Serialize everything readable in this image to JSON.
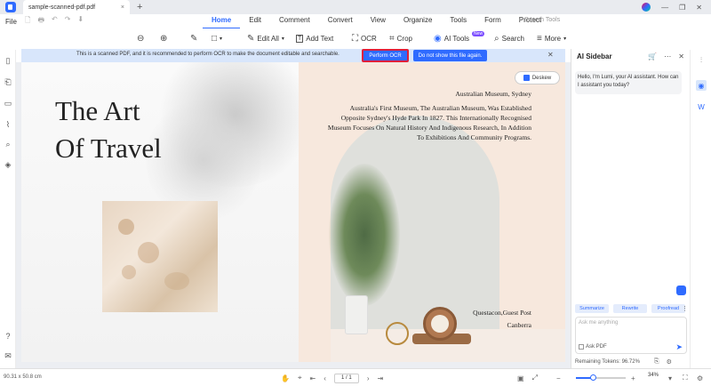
{
  "titlebar": {
    "tab_title": "sample-scanned-pdf.pdf",
    "close": "×",
    "new_tab": "+",
    "controls": [
      "—",
      "❐",
      "✕"
    ]
  },
  "menubar": {
    "file": "File",
    "quick_access": [
      "🗋",
      "🖶",
      "↶",
      "↷",
      "⬇"
    ],
    "menus": [
      {
        "label": "Home",
        "active": true
      },
      {
        "label": "Edit"
      },
      {
        "label": "Comment"
      },
      {
        "label": "Convert"
      },
      {
        "label": "View"
      },
      {
        "label": "Organize"
      },
      {
        "label": "Tools"
      },
      {
        "label": "Form"
      },
      {
        "label": "Protect"
      }
    ],
    "search_placeholder": "Search Tools"
  },
  "toolbar": {
    "zoom_out": "⊖",
    "zoom_in": "⊕",
    "highlight": "✎",
    "shape": "□",
    "edit_all": "Edit All",
    "add_text": "Add Text",
    "ocr": "OCR",
    "crop": "Crop",
    "ai_tools": "AI Tools",
    "ai_badge": "New",
    "search": "Search",
    "more": "More"
  },
  "infobar": {
    "message": "This is a scanned PDF, and it is recommended to perform OCR to make the document editable and searchable.",
    "perform_ocr": "Perform OCR",
    "dont_show": "Do not show this file again."
  },
  "page": {
    "title_line1": "The Art",
    "title_line2": "Of Travel",
    "deskew": "Deskew",
    "museum_heading": "Australian Museum, Sydney",
    "museum_text": "Australia's First Museum, The Australian Museum, Was Established Opposite Sydney's Hyde Park In 1827. This Internationally Recognised Museum Focuses On Natural History And Indigenous Research, In Addition To Exhibitions And Community Programs.",
    "quest_line1": "Questacon,Guest Post",
    "quest_line2": "Canberra"
  },
  "sidebar": {
    "title": "AI Sidebar",
    "greeting": "Hello, I'm Lumi, your AI assistant. How can I assistant you today?",
    "chips": [
      "Summarize",
      "Rewrite",
      "Proofread"
    ],
    "ask_placeholder": "Ask me anything",
    "ask_pdf": "Ask PDF",
    "tokens": "Remaining Tokens: 96.72%"
  },
  "status": {
    "dimensions": "90.31 x 50.8 cm",
    "page_indicator": "1 / 1",
    "zoom": "34%",
    "zoom_level": 0.34
  },
  "colors": {
    "accent": "#2f6bff",
    "highlight_border": "#e0203a"
  }
}
